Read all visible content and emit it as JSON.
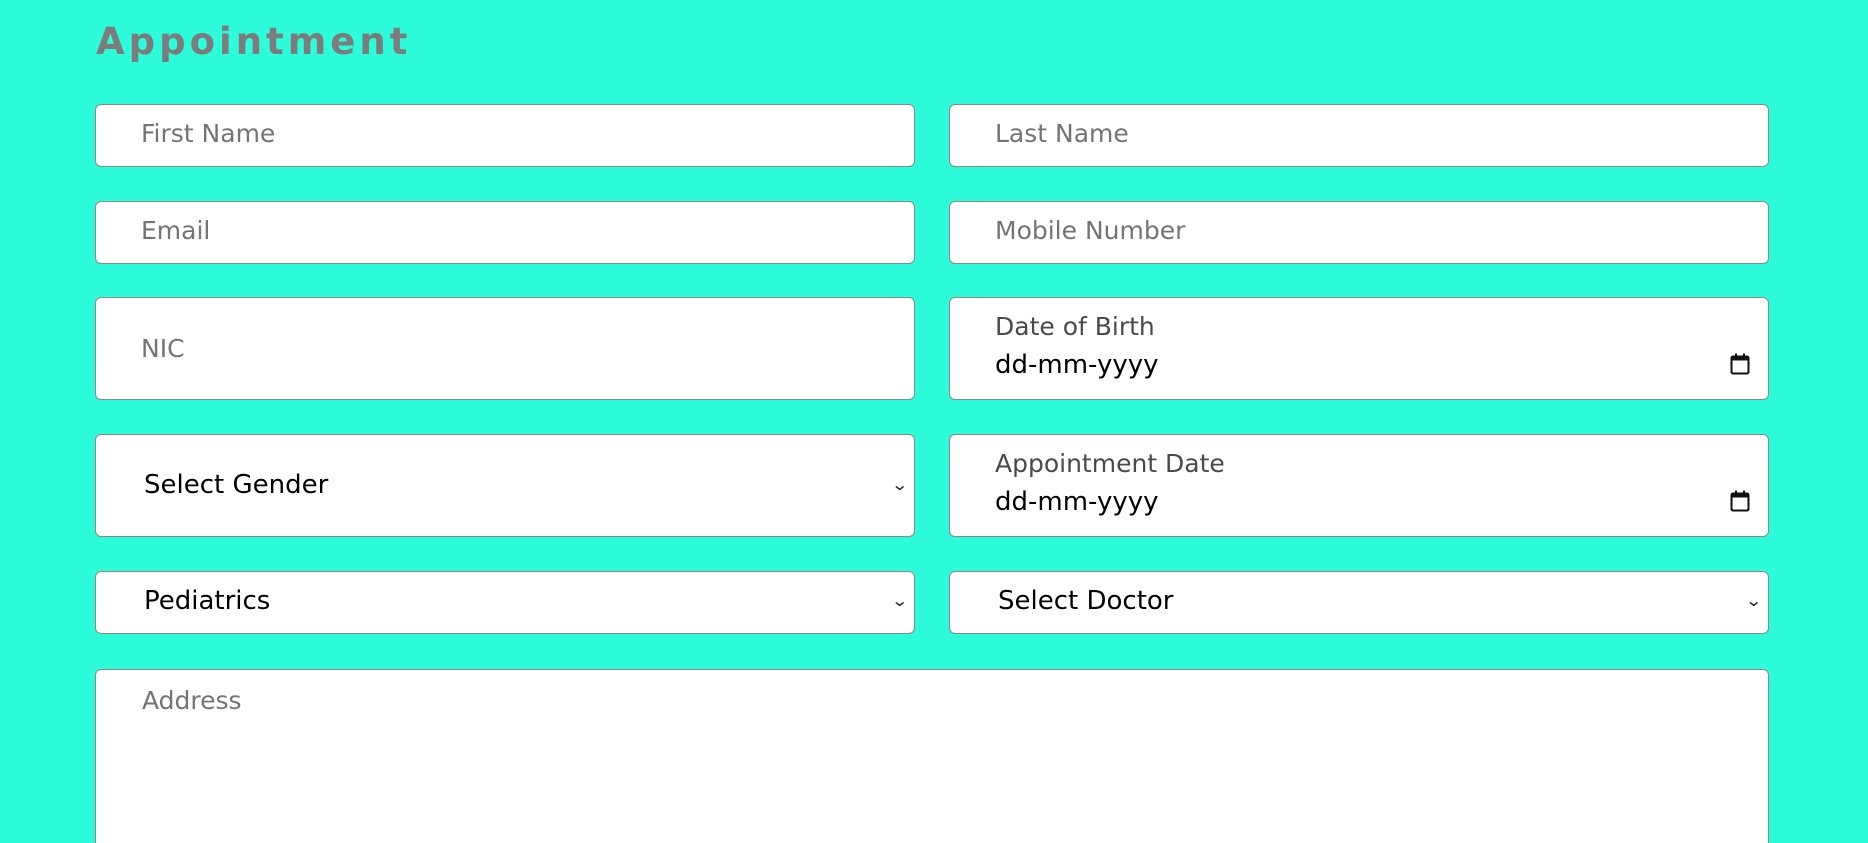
{
  "page": {
    "title": "Appointment"
  },
  "form": {
    "first_name_placeholder": "First Name",
    "last_name_placeholder": "Last Name",
    "email_placeholder": "Email",
    "mobile_placeholder": "Mobile Number",
    "nic_placeholder": "NIC",
    "dob_label": "Date of Birth",
    "dob_value": "dd-mm-yyyy",
    "gender_selected": "Select Gender",
    "appointment_date_label": "Appointment Date",
    "appointment_date_value": "dd-mm-yyyy",
    "department_selected": "Pediatrics",
    "doctor_selected": "Select Doctor",
    "address_placeholder": "Address"
  },
  "colors": {
    "background": "#2cfcda",
    "title": "#7c7c7c",
    "field_bg": "#ffffff",
    "field_border": "#8a8a8a"
  },
  "icons": {
    "calendar": "calendar-icon",
    "dropdown": "chevron-down-icon"
  }
}
